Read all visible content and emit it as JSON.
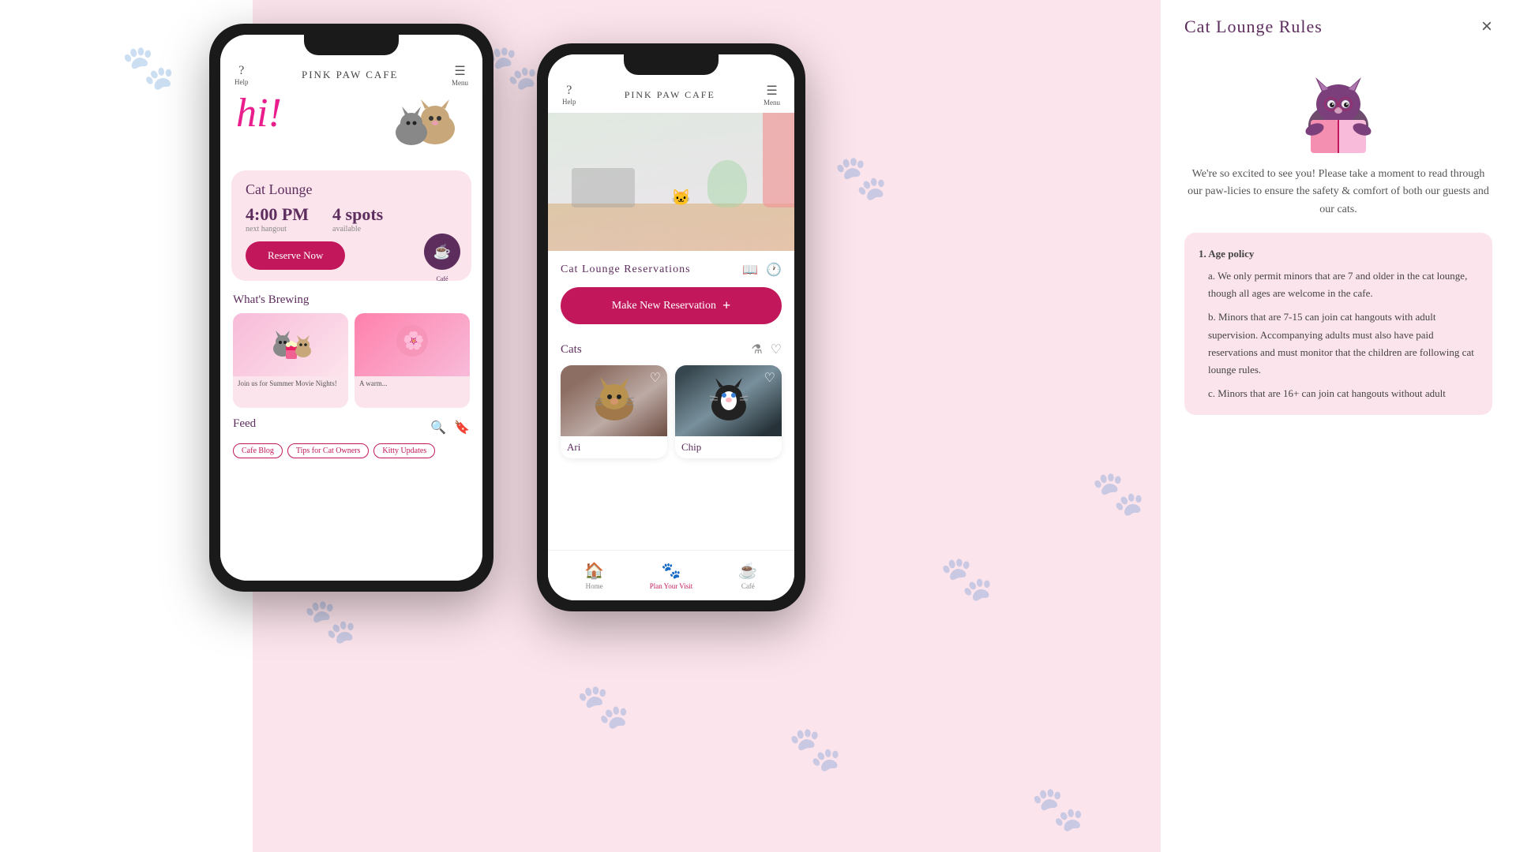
{
  "background": {
    "color": "#fce4ec"
  },
  "phone_left": {
    "header": {
      "help_label": "?",
      "help_text": "Help",
      "title": "PINK PAW CAFE",
      "menu_icon": "☰",
      "menu_text": "Menu"
    },
    "hi_section": {
      "greeting": "hi!",
      "illustration_emoji": "🐱"
    },
    "lounge_card": {
      "title": "Cat Lounge",
      "time": "4:00 PM",
      "time_label": "next hangout",
      "spots": "4 spots",
      "spots_label": "available",
      "reserve_btn": "Reserve Now",
      "cafe_icon": "☕",
      "cafe_label": "Café"
    },
    "brewing": {
      "title": "What's Brewing",
      "card1_label": "Join us for Summer Movie Nights!",
      "card2_label": "A warm..."
    },
    "feed": {
      "title": "Feed",
      "search_icon": "🔍",
      "bookmark_icon": "🔖",
      "tags": [
        "Cafe Blog",
        "Tips for Cat Owners",
        "Kitty Updates"
      ]
    }
  },
  "phone_center": {
    "header": {
      "help_icon": "?",
      "help_text": "Help",
      "title": "PINK PAW CAFE",
      "menu_icon": "☰",
      "menu_text": "Menu"
    },
    "reservations": {
      "title": "Cat Lounge Reservations",
      "book_icon": "📖",
      "history_icon": "🕐",
      "make_reservation_btn": "Make New Reservation",
      "plus_icon": "+"
    },
    "cats": {
      "title": "Cats",
      "filter_icon": "⚗",
      "heart_icon": "♡",
      "list": [
        {
          "name": "Ari",
          "type": "tabby"
        },
        {
          "name": "Chip",
          "type": "tuxedo"
        }
      ]
    },
    "bottom_nav": {
      "home_label": "Home",
      "plan_label": "Plan Your Visit",
      "cafe_label": "Café"
    }
  },
  "rules_panel": {
    "title": "Cat Lounge Rules",
    "close_icon": "×",
    "intro": "We're so excited to see you! Please take a moment to read through our paw-licies to ensure the safety & comfort of both our guests and our cats.",
    "rules": {
      "age_policy_title": "1. Age policy",
      "rule_a": "a. We only permit minors that are 7 and older in the cat lounge, though all ages are welcome in the cafe.",
      "rule_b": "b. Minors that are 7-15 can join cat hangouts with adult supervision. Accompanying adults must also have paid reservations and must monitor that the children are following cat lounge rules.",
      "rule_c": "c. Minors that are 16+ can join cat hangouts without adult"
    }
  }
}
